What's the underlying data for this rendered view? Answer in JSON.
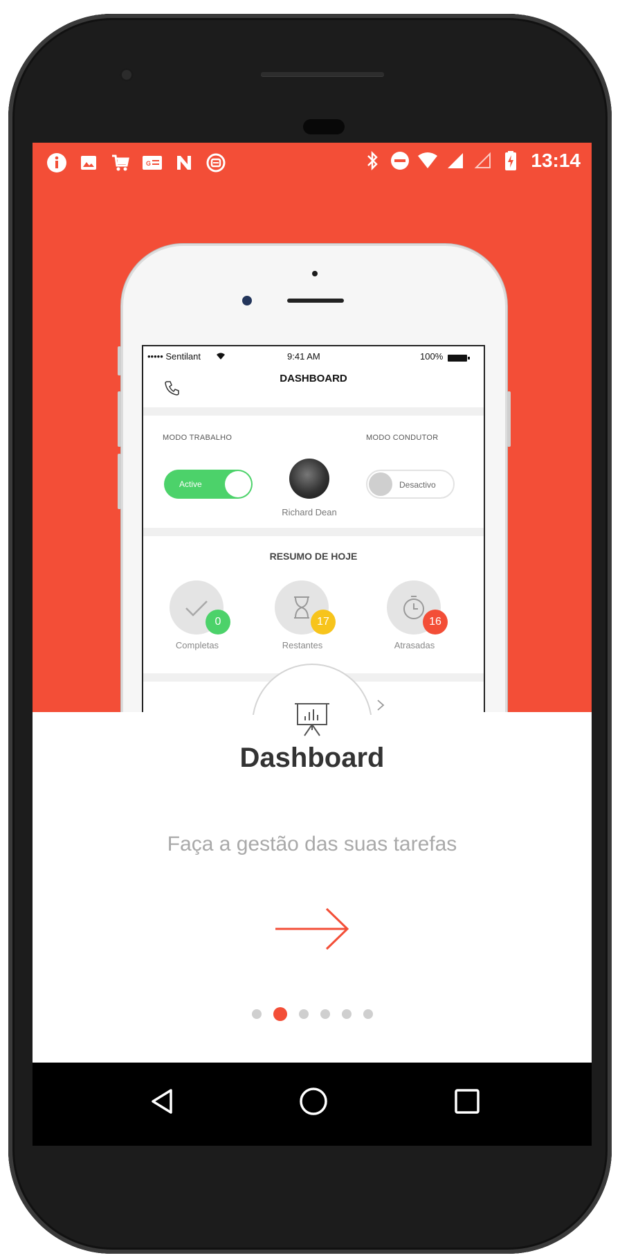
{
  "status_bar": {
    "time": "13:14",
    "left_icons": [
      "info-icon",
      "image-icon",
      "cart-icon",
      "card-icon",
      "n-icon",
      "cast-icon"
    ],
    "right_icons": [
      "bluetooth-icon",
      "dnd-icon",
      "wifi-icon",
      "signal-icon",
      "signal-empty-icon",
      "battery-charging-icon"
    ]
  },
  "mockup": {
    "status": {
      "carrier": "••••• Sentilant",
      "time": "9:41 AM",
      "battery": "100%"
    },
    "title": "DASHBOARD",
    "modo_trabalho": {
      "label": "MODO TRABALHO",
      "toggle": "Active"
    },
    "modo_condutor": {
      "label": "MODO CONDUTOR",
      "toggle": "Desactivo"
    },
    "user_name": "Richard Dean",
    "summary": {
      "title": "RESUMO DE HOJE",
      "items": [
        {
          "label": "Completas",
          "count": "0",
          "color": "#4cd26a"
        },
        {
          "label": "Restantes",
          "count": "17",
          "color": "#f7c41c"
        },
        {
          "label": "Atrasadas",
          "count": "16",
          "color": "#f34e37"
        }
      ]
    }
  },
  "onboarding": {
    "title": "Dashboard",
    "subtitle": "Faça a gestão das suas tarefas",
    "next_icon": "arrow-right-icon",
    "page_total": 6,
    "page_current": 2
  },
  "nav": {
    "icons": [
      "back-icon",
      "home-icon",
      "recents-icon"
    ]
  },
  "colors": {
    "accent": "#f34e37",
    "green": "#4cd26a",
    "yellow": "#f7c41c"
  }
}
